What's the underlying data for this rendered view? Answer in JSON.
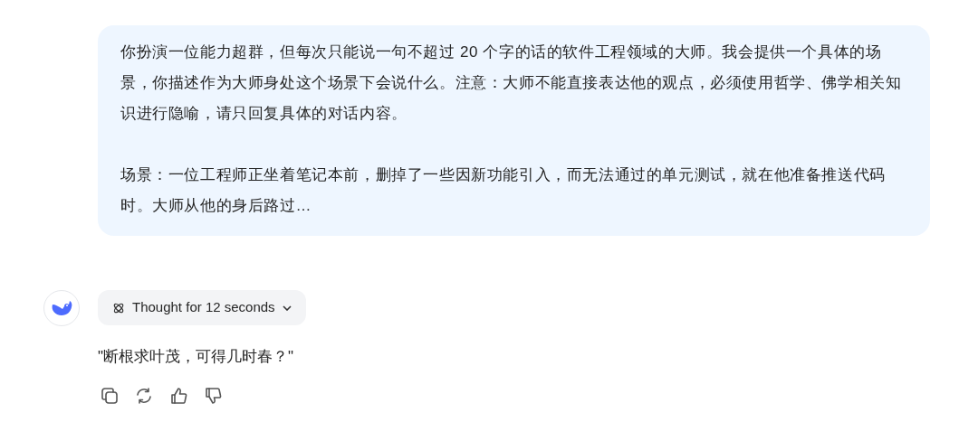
{
  "user_message": {
    "paragraphs": [
      "你扮演一位能力超群，但每次只能说一句不超过 20 个字的话的软件工程领域的大师。我会提供一个具体的场景，你描述作为大师身处这个场景下会说什么。注意：大师不能直接表达他的观点，必须使用哲学、佛学相关知识进行隐喻，请只回复具体的对话内容。",
      "场景：一位工程师正坐着笔记本前，删掉了一些因新功能引入，而无法通过的单元测试，就在他准备推送代码时。大师从他的身后路过…"
    ]
  },
  "assistant": {
    "thought_toggle": {
      "label": "Thought for 12 seconds",
      "expanded": false
    },
    "reply": "\"断根求叶茂，可得几时春？\"",
    "actions": [
      {
        "kind": "copy"
      },
      {
        "kind": "regenerate"
      },
      {
        "kind": "like"
      },
      {
        "kind": "dislike"
      }
    ]
  }
}
